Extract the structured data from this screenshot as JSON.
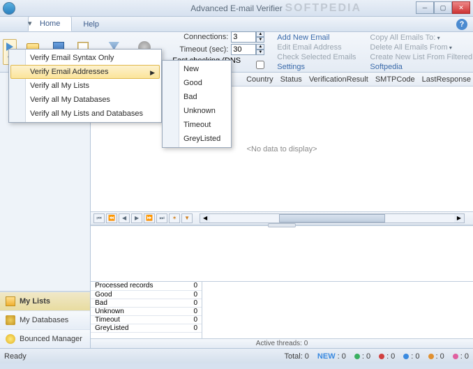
{
  "window": {
    "title": "Advanced E-mail Verifier",
    "watermark": "SOFTPEDIA"
  },
  "tabs": {
    "home": "Home",
    "help": "Help"
  },
  "ribbon": {
    "save": "Save",
    "filter": "Filter",
    "settings": "Settings",
    "connections_label": "Connections:",
    "connections_value": "3",
    "timeout_label": "Timeout (sec):",
    "timeout_value": "30",
    "fast_checking": "Fast checking (DNS query only)",
    "settings_link": "Settings",
    "col2": {
      "add": "Add New Email",
      "edit": "Edit Email Address",
      "check": "Check Selected Emails"
    },
    "col3": {
      "copy": "Copy All Emails To:",
      "delete": "Delete All Emails From",
      "create": "Create New List From Filtered Data",
      "softpedia": "Softpedia"
    }
  },
  "grid": {
    "columns": [
      "Country",
      "Status",
      "VerificationResult",
      "SMTPCode",
      "LastResponse"
    ],
    "empty": "<No data to display>"
  },
  "sidebar": {
    "lists": "My Lists",
    "databases": "My Databases",
    "bounced": "Bounced Manager"
  },
  "stats": {
    "rows": [
      [
        "Processed records",
        "0"
      ],
      [
        "Good",
        "0"
      ],
      [
        "Bad",
        "0"
      ],
      [
        "Unknown",
        "0"
      ],
      [
        "Timeout",
        "0"
      ],
      [
        "GreyListed",
        "0"
      ]
    ],
    "active_threads": "Active threads: 0"
  },
  "statusbar": {
    "ready": "Ready",
    "total": "Total: 0",
    "new": "NEW",
    "items": [
      ": 0",
      ": 0",
      ": 0",
      ": 0",
      ": 0",
      ": 0"
    ]
  },
  "menu1": {
    "items": [
      "Verify Email Syntax Only",
      "Verify Email Addresses",
      "Verify all My Lists",
      "Verify all My Databases",
      "Verify all My Lists and Databases"
    ]
  },
  "menu2": {
    "items": [
      "New",
      "Good",
      "Bad",
      "Unknown",
      "Timeout",
      "GreyListed"
    ]
  }
}
